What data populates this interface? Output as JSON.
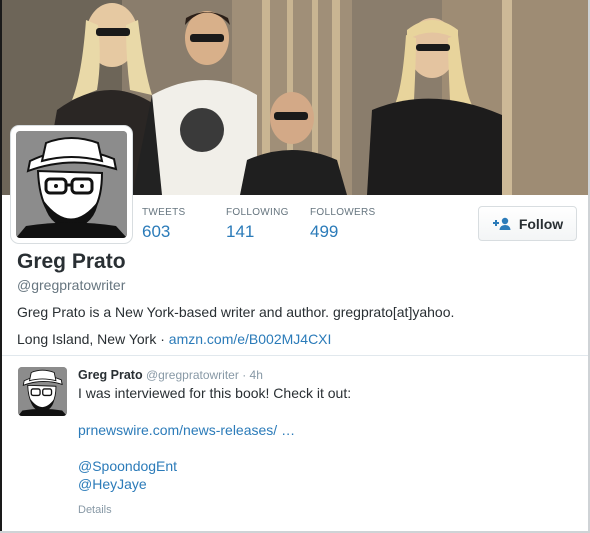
{
  "profile": {
    "name": "Greg Prato",
    "handle": "@gregpratowriter",
    "bio": "Greg Prato is a New York-based writer and author. gregprato[at]yahoo.",
    "location": "Long Island, New York",
    "separator": "·",
    "website": "amzn.com/e/B002MJ4CXI"
  },
  "stats": [
    {
      "label": "TWEETS",
      "value": "603"
    },
    {
      "label": "FOLLOWING",
      "value": "141"
    },
    {
      "label": "FOLLOWERS",
      "value": "499"
    }
  ],
  "follow_button": {
    "label": "Follow",
    "icon": "add-user-icon"
  },
  "tweet": {
    "author_name": "Greg Prato",
    "author_handle": "@gregpratowriter",
    "time": "· 4h",
    "text": "I was interviewed for this book! Check it out:",
    "link": "prnewswire.com/news-releases/ …",
    "mentions": [
      "@SpoondogEnt",
      "@HeyJaye"
    ],
    "details_label": "Details"
  },
  "colors": {
    "link": "#2b7bb9",
    "text": "#292f33",
    "muted": "#66757f"
  }
}
